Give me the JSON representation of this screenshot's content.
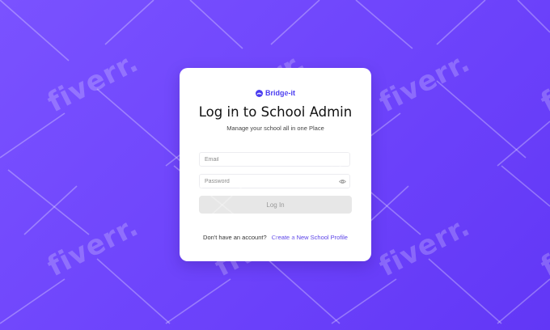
{
  "brand": {
    "name": "Bridge-it",
    "icon": "bridge-logo-icon",
    "color": "#4a3cf0"
  },
  "login": {
    "title": "Log in to School Admin",
    "subtitle": "Manage your school all in one Place",
    "email_placeholder": "Email",
    "password_placeholder": "Password",
    "password_toggle_icon": "eye-icon",
    "submit_label": "Log In",
    "signup_prompt": "Don't have an account?",
    "signup_link": "Create a New School Profile"
  },
  "watermark": {
    "text": "fiverr."
  },
  "colors": {
    "background": "#6d43fb",
    "card": "#ffffff",
    "link": "#5b43e8",
    "button_disabled": "#e7e7e7"
  }
}
